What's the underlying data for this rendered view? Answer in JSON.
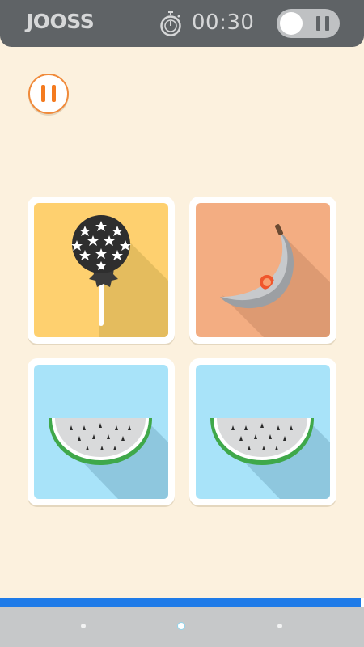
{
  "header": {
    "logo": "JOOSS",
    "timer": "00:30",
    "timer_icon": "stopwatch-icon",
    "toggle_state": "off"
  },
  "controls": {
    "pause_icon": "pause-icon"
  },
  "cards": [
    {
      "icon": "lollipop-icon",
      "background": "#fed06f"
    },
    {
      "icon": "banana-icon",
      "background": "#f3ad82"
    },
    {
      "icon": "watermelon-icon",
      "background": "#a8e3f9"
    },
    {
      "icon": "watermelon-icon",
      "background": "#a8e3f9"
    }
  ],
  "progress": {
    "fraction": 0.99
  },
  "colors": {
    "background": "#fcf1de",
    "topbar": "#5f6366",
    "accent": "#f47b20",
    "progress": "#1e7be8"
  }
}
